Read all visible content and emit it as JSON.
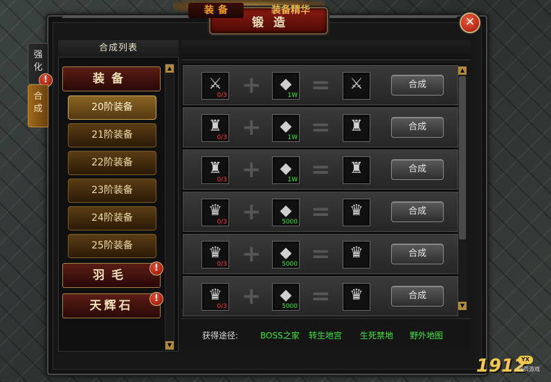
{
  "window": {
    "title": "锻造",
    "close_label": "✕"
  },
  "side_tabs": [
    {
      "label": "强化"
    },
    {
      "label": "合成"
    }
  ],
  "left_panel": {
    "header": "合成列表",
    "categories": {
      "equipment": "装备",
      "feather": "羽毛",
      "gem": "天辉石"
    },
    "tiers": [
      "20阶装备",
      "21阶装备",
      "22阶装备",
      "23阶装备",
      "24阶装备",
      "25阶装备"
    ],
    "selected_tier": "20阶装备"
  },
  "tabs": {
    "equipment": "装备",
    "essence": "装备精华"
  },
  "rows": [
    {
      "input_count": "0/3",
      "material_count": "1W",
      "button": "合成",
      "item_icon": "weapon-icon"
    },
    {
      "input_count": "0/3",
      "material_count": "1W",
      "button": "合成",
      "item_icon": "armor-icon"
    },
    {
      "input_count": "0/3",
      "material_count": "1W",
      "button": "合成",
      "item_icon": "armor-icon"
    },
    {
      "input_count": "0/3",
      "material_count": "5000",
      "button": "合成",
      "item_icon": "helmet-icon"
    },
    {
      "input_count": "0/3",
      "material_count": "5000",
      "button": "合成",
      "item_icon": "helmet-icon"
    },
    {
      "input_count": "0/3",
      "material_count": "5000",
      "button": "合成",
      "item_icon": "helmet-icon"
    }
  ],
  "footer": {
    "label": "获得途径:",
    "links": [
      "BOSS之家",
      "转生地宫",
      "生死禁地",
      "野外地图"
    ]
  },
  "branding": {
    "logo": "1912",
    "badge": "YX",
    "tag": "网页游戏"
  },
  "colors": {
    "count_red": "#ff3b2f",
    "count_green": "#3ee83a",
    "tab_active": "#f2a01c"
  }
}
